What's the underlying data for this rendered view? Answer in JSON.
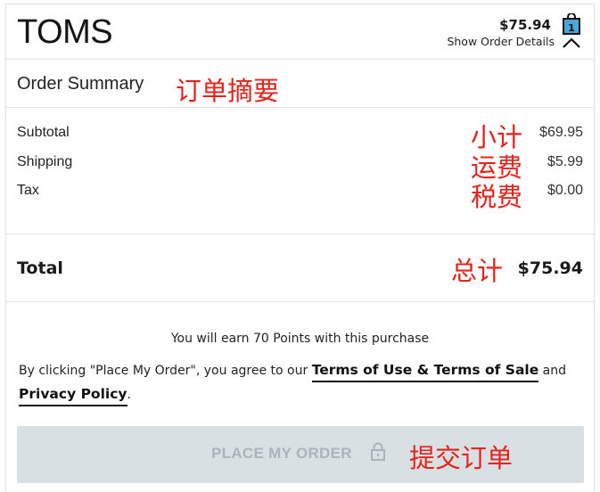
{
  "header": {
    "brand": "TOMS",
    "order_total": "$75.94",
    "show_details": "Show Order Details",
    "bag_count": "1",
    "bag_icon": "shopping-bag-icon",
    "toggle_icon": "chevron-up-icon"
  },
  "summary": {
    "title": "Order Summary",
    "title_annotation": "订单摘要",
    "rows": [
      {
        "label": "Subtotal",
        "value": "$69.95",
        "annotation": "小计"
      },
      {
        "label": "Shipping",
        "value": "$5.99",
        "annotation": "运费"
      },
      {
        "label": "Tax",
        "value": "$0.00",
        "annotation": "税费"
      }
    ],
    "total_label": "Total",
    "total_value": "$75.94",
    "total_annotation": "总计"
  },
  "footer": {
    "points_text": "You will earn 70 Points with this purchase",
    "agree_prefix": "By clicking \"Place My Order\", you agree to our ",
    "terms_link": "Terms of Use & Terms of Sale",
    "and_text": " and",
    "privacy_link": "Privacy Policy",
    "period": ".",
    "place_order_label": "PLACE MY ORDER",
    "lock_icon": "lock-icon",
    "place_order_annotation": "提交订单"
  },
  "colors": {
    "annotation": "#e5231b",
    "button_bg": "#d9e0e4",
    "button_text": "#aab4ba",
    "bag_fill": "#4aa6d6"
  }
}
